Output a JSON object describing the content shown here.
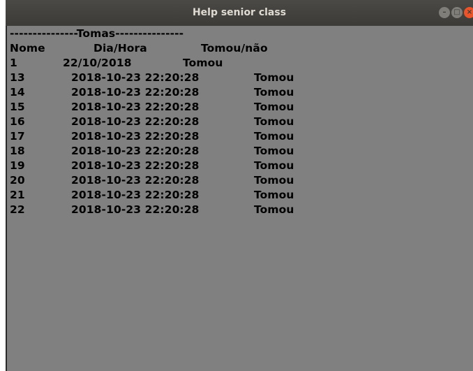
{
  "window": {
    "title": "Help senior class",
    "controls": [
      "minimize",
      "maximize",
      "close"
    ]
  },
  "content": {
    "section_header": "---------------Tomas---------------",
    "columns": [
      "Nome",
      "Dia/Hora",
      "Tomou/não"
    ],
    "first_row": {
      "nome": "1",
      "data": "22/10/2018",
      "status": "Tomou"
    },
    "rows": [
      {
        "nome": "13",
        "data": "2018-10-23 22:20:28",
        "status": "Tomou"
      },
      {
        "nome": "14",
        "data": "2018-10-23 22:20:28",
        "status": "Tomou"
      },
      {
        "nome": "15",
        "data": "2018-10-23 22:20:28",
        "status": "Tomou"
      },
      {
        "nome": "16",
        "data": "2018-10-23 22:20:28",
        "status": "Tomou"
      },
      {
        "nome": "17",
        "data": "2018-10-23 22:20:28",
        "status": "Tomou"
      },
      {
        "nome": "18",
        "data": "2018-10-23 22:20:28",
        "status": "Tomou"
      },
      {
        "nome": "19",
        "data": "2018-10-23 22:20:28",
        "status": "Tomou"
      },
      {
        "nome": "20",
        "data": "2018-10-23 22:20:28",
        "status": "Tomou"
      },
      {
        "nome": "21",
        "data": "2018-10-23 22:20:28",
        "status": "Tomou"
      },
      {
        "nome": "22",
        "data": "2018-10-23 22:20:28",
        "status": "Tomou"
      }
    ]
  },
  "colors": {
    "background": "#808080",
    "titlebar": "#3c3b37",
    "close_button": "#e9542a"
  }
}
